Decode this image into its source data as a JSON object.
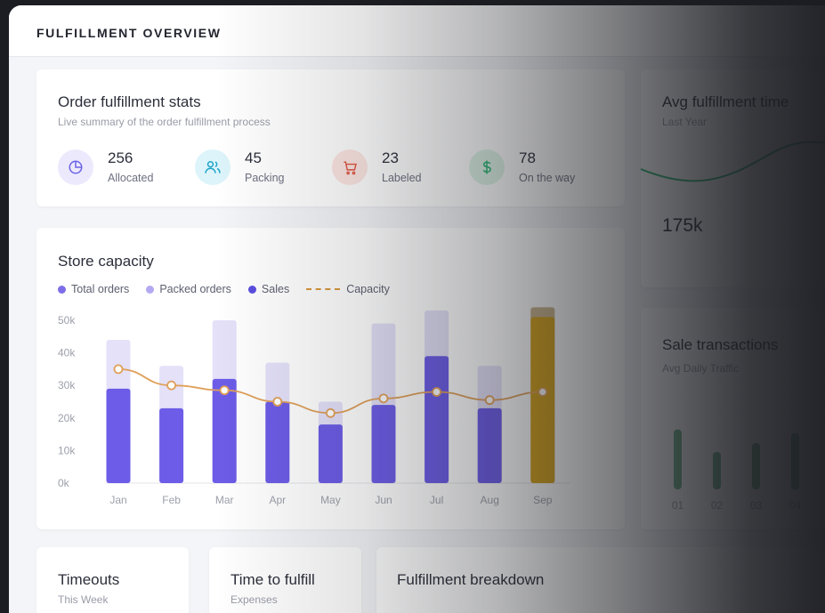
{
  "header": {
    "title": "FULFILLMENT OVERVIEW"
  },
  "stats_card": {
    "title": "Order fulfillment stats",
    "subtitle": "Live summary of the order fulfillment process",
    "items": [
      {
        "value": "256",
        "label": "Allocated",
        "icon": "pie-chart-icon",
        "color": "#6c63e8",
        "bg": "#ece9fd"
      },
      {
        "value": "45",
        "label": "Packing",
        "icon": "users-icon",
        "color": "#1fa5c9",
        "bg": "#dcf4fa"
      },
      {
        "value": "23",
        "label": "Labeled",
        "icon": "cart-icon",
        "color": "#e0533f",
        "bg": "#fde6e2"
      },
      {
        "value": "78",
        "label": "On the way",
        "icon": "dollar-icon",
        "color": "#2bb673",
        "bg": "#def5e8"
      }
    ]
  },
  "avg_card": {
    "title": "Avg fulfillment time",
    "subtitle": "Last Year",
    "value": "175k",
    "line_color": "#2bb673"
  },
  "capacity_card": {
    "title": "Store capacity",
    "legend": [
      {
        "label": "Total orders",
        "color": "#7c6ee8"
      },
      {
        "label": "Packed orders",
        "color": "#b3a9f2"
      },
      {
        "label": "Sales",
        "color": "#5b4ee0"
      },
      {
        "label": "Capacity",
        "color": "#d9973a"
      }
    ]
  },
  "chart_data": {
    "type": "bar",
    "categories": [
      "Jan",
      "Feb",
      "Mar",
      "Apr",
      "May",
      "Jun",
      "Jul",
      "Aug",
      "Sep"
    ],
    "series": [
      {
        "name": "Total orders",
        "values": [
          44,
          36,
          50,
          37,
          25,
          49,
          53,
          36,
          54
        ]
      },
      {
        "name": "Sales",
        "values": [
          29,
          23,
          32,
          25,
          18,
          24,
          39,
          23,
          51
        ]
      },
      {
        "name": "Capacity",
        "values": [
          35,
          30,
          28.5,
          25,
          21.5,
          26,
          28,
          25.5,
          28
        ]
      }
    ],
    "y_ticks": [
      "0k",
      "10k",
      "20k",
      "30k",
      "40k",
      "50k"
    ],
    "ylim": [
      0,
      50
    ],
    "highlight_index": 8,
    "colors": {
      "bar": "#6c5ce7",
      "bar_bg": "#e4e1f9",
      "highlight": "#d4a21c",
      "line": "#e0a05a"
    }
  },
  "sale_card": {
    "title": "Sale transactions",
    "subtitle": "Avg Daily Traffic",
    "labels": [
      "01",
      "02",
      "03",
      "04"
    ],
    "values": [
      80,
      50,
      62,
      75
    ]
  },
  "bottom": [
    {
      "title": "Timeouts",
      "subtitle": "This Week"
    },
    {
      "title": "Time to fulfill",
      "subtitle": "Expenses"
    },
    {
      "title": "Fulfillment breakdown",
      "subtitle": ""
    }
  ]
}
